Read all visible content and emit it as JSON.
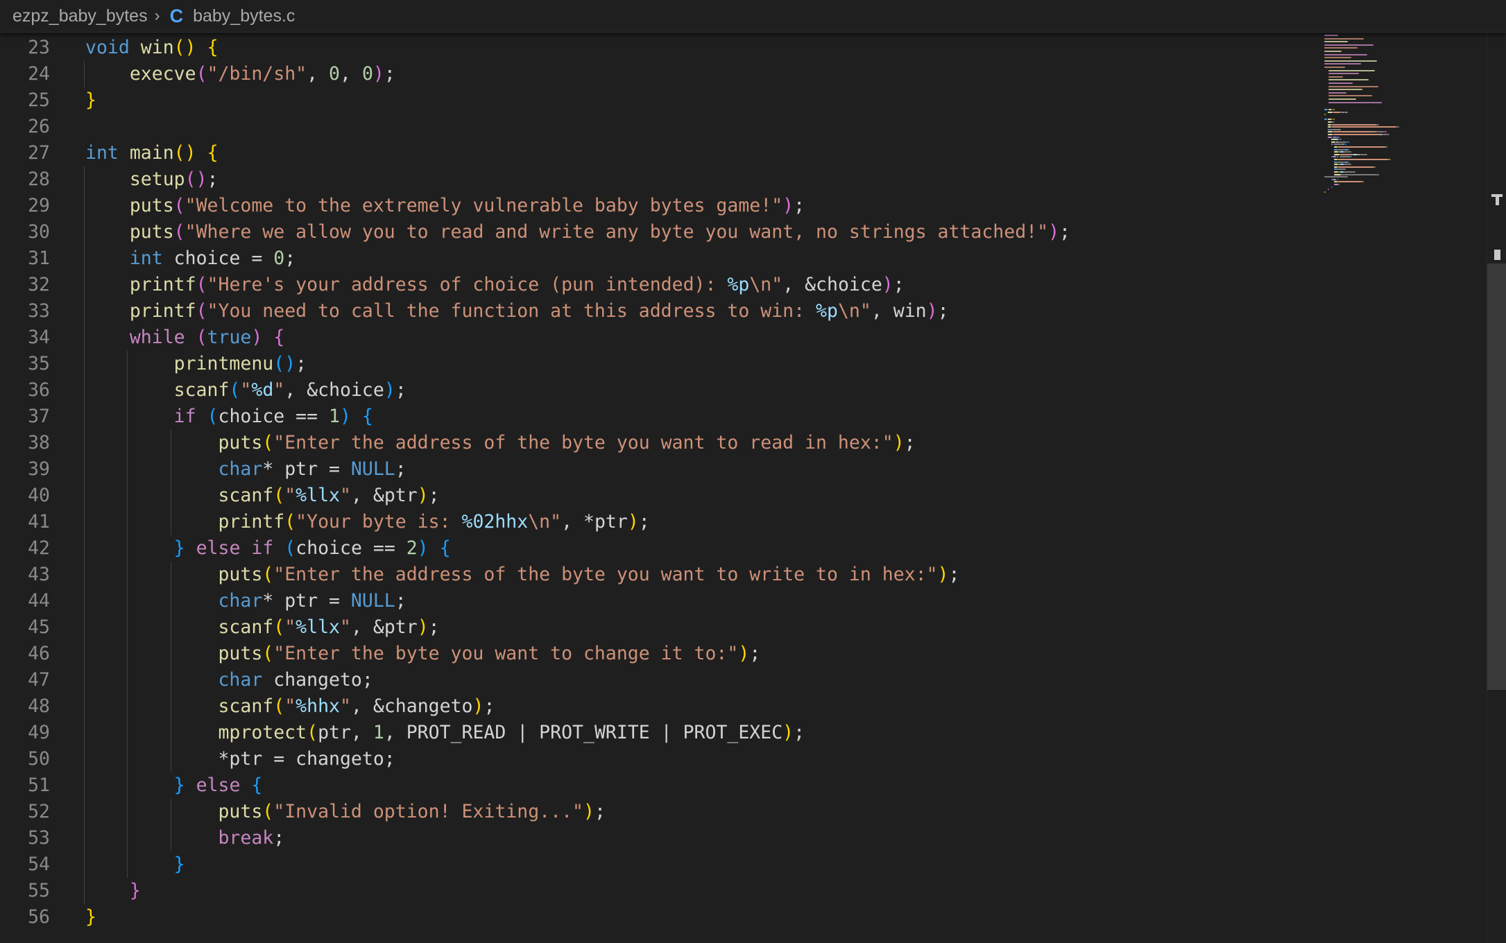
{
  "breadcrumb": {
    "folder": "ezpz_baby_bytes",
    "separator": "›",
    "file_icon": "C",
    "file": "baby_bytes.c"
  },
  "editor": {
    "language": "c",
    "lines": [
      {
        "n": "23",
        "tokens": [
          [
            "kw",
            "void"
          ],
          [
            "plain",
            " "
          ],
          [
            "fn",
            "win"
          ],
          [
            "b1",
            "()"
          ],
          [
            "plain",
            " "
          ],
          [
            "b1",
            "{"
          ]
        ]
      },
      {
        "n": "24",
        "tokens": [
          [
            "plain",
            "    "
          ],
          [
            "fn",
            "execve"
          ],
          [
            "b2",
            "("
          ],
          [
            "str",
            "\"/bin/sh\""
          ],
          [
            "plain",
            ", "
          ],
          [
            "num",
            "0"
          ],
          [
            "plain",
            ", "
          ],
          [
            "num",
            "0"
          ],
          [
            "b2",
            ")"
          ],
          [
            "plain",
            ";"
          ]
        ]
      },
      {
        "n": "25",
        "tokens": [
          [
            "b1",
            "}"
          ]
        ]
      },
      {
        "n": "26",
        "tokens": []
      },
      {
        "n": "27",
        "tokens": [
          [
            "kw",
            "int"
          ],
          [
            "plain",
            " "
          ],
          [
            "fn",
            "main"
          ],
          [
            "b1",
            "()"
          ],
          [
            "plain",
            " "
          ],
          [
            "b1",
            "{"
          ]
        ]
      },
      {
        "n": "28",
        "tokens": [
          [
            "plain",
            "    "
          ],
          [
            "fn",
            "setup"
          ],
          [
            "b2",
            "()"
          ],
          [
            "plain",
            ";"
          ]
        ]
      },
      {
        "n": "29",
        "tokens": [
          [
            "plain",
            "    "
          ],
          [
            "fn",
            "puts"
          ],
          [
            "b2",
            "("
          ],
          [
            "str",
            "\"Welcome to the extremely vulnerable baby bytes game!\""
          ],
          [
            "b2",
            ")"
          ],
          [
            "plain",
            ";"
          ]
        ]
      },
      {
        "n": "30",
        "tokens": [
          [
            "plain",
            "    "
          ],
          [
            "fn",
            "puts"
          ],
          [
            "b2",
            "("
          ],
          [
            "str",
            "\"Where we allow you to read and write any byte you want, no strings attached!\""
          ],
          [
            "b2",
            ")"
          ],
          [
            "plain",
            ";"
          ]
        ]
      },
      {
        "n": "31",
        "tokens": [
          [
            "plain",
            "    "
          ],
          [
            "kw",
            "int"
          ],
          [
            "plain",
            " choice = "
          ],
          [
            "num",
            "0"
          ],
          [
            "plain",
            ";"
          ]
        ]
      },
      {
        "n": "32",
        "tokens": [
          [
            "plain",
            "    "
          ],
          [
            "fn",
            "printf"
          ],
          [
            "b2",
            "("
          ],
          [
            "str",
            "\"Here's your address of choice (pun intended): "
          ],
          [
            "fmt",
            "%p"
          ],
          [
            "str",
            "\\n\""
          ],
          [
            "plain",
            ", &choice"
          ],
          [
            "b2",
            ")"
          ],
          [
            "plain",
            ";"
          ]
        ]
      },
      {
        "n": "33",
        "tokens": [
          [
            "plain",
            "    "
          ],
          [
            "fn",
            "printf"
          ],
          [
            "b2",
            "("
          ],
          [
            "str",
            "\"You need to call the function at this address to win: "
          ],
          [
            "fmt",
            "%p"
          ],
          [
            "str",
            "\\n\""
          ],
          [
            "plain",
            ", win"
          ],
          [
            "b2",
            ")"
          ],
          [
            "plain",
            ";"
          ]
        ]
      },
      {
        "n": "34",
        "tokens": [
          [
            "plain",
            "    "
          ],
          [
            "ctl",
            "while"
          ],
          [
            "plain",
            " "
          ],
          [
            "b2",
            "("
          ],
          [
            "kw",
            "true"
          ],
          [
            "b2",
            ")"
          ],
          [
            "plain",
            " "
          ],
          [
            "b2",
            "{"
          ]
        ]
      },
      {
        "n": "35",
        "tokens": [
          [
            "plain",
            "        "
          ],
          [
            "fn",
            "printmenu"
          ],
          [
            "b3",
            "()"
          ],
          [
            "plain",
            ";"
          ]
        ]
      },
      {
        "n": "36",
        "tokens": [
          [
            "plain",
            "        "
          ],
          [
            "fn",
            "scanf"
          ],
          [
            "b3",
            "("
          ],
          [
            "str",
            "\""
          ],
          [
            "fmt",
            "%d"
          ],
          [
            "str",
            "\""
          ],
          [
            "plain",
            ", &choice"
          ],
          [
            "b3",
            ")"
          ],
          [
            "plain",
            ";"
          ]
        ]
      },
      {
        "n": "37",
        "tokens": [
          [
            "plain",
            "        "
          ],
          [
            "ctl",
            "if"
          ],
          [
            "plain",
            " "
          ],
          [
            "b3",
            "("
          ],
          [
            "plain",
            "choice == "
          ],
          [
            "num",
            "1"
          ],
          [
            "b3",
            ")"
          ],
          [
            "plain",
            " "
          ],
          [
            "b3",
            "{"
          ]
        ]
      },
      {
        "n": "38",
        "tokens": [
          [
            "plain",
            "            "
          ],
          [
            "fn",
            "puts"
          ],
          [
            "b1",
            "("
          ],
          [
            "str",
            "\"Enter the address of the byte you want to read in hex:\""
          ],
          [
            "b1",
            ")"
          ],
          [
            "plain",
            ";"
          ]
        ]
      },
      {
        "n": "39",
        "tokens": [
          [
            "plain",
            "            "
          ],
          [
            "kw",
            "char"
          ],
          [
            "plain",
            "* ptr = "
          ],
          [
            "kw",
            "NULL"
          ],
          [
            "plain",
            ";"
          ]
        ]
      },
      {
        "n": "40",
        "tokens": [
          [
            "plain",
            "            "
          ],
          [
            "fn",
            "scanf"
          ],
          [
            "b1",
            "("
          ],
          [
            "str",
            "\""
          ],
          [
            "fmt",
            "%llx"
          ],
          [
            "str",
            "\""
          ],
          [
            "plain",
            ", &ptr"
          ],
          [
            "b1",
            ")"
          ],
          [
            "plain",
            ";"
          ]
        ]
      },
      {
        "n": "41",
        "tokens": [
          [
            "plain",
            "            "
          ],
          [
            "fn",
            "printf"
          ],
          [
            "b1",
            "("
          ],
          [
            "str",
            "\"Your byte is: "
          ],
          [
            "fmt",
            "%02hhx"
          ],
          [
            "str",
            "\\n\""
          ],
          [
            "plain",
            ", *ptr"
          ],
          [
            "b1",
            ")"
          ],
          [
            "plain",
            ";"
          ]
        ]
      },
      {
        "n": "42",
        "tokens": [
          [
            "plain",
            "        "
          ],
          [
            "b3",
            "}"
          ],
          [
            "plain",
            " "
          ],
          [
            "ctl",
            "else"
          ],
          [
            "plain",
            " "
          ],
          [
            "ctl",
            "if"
          ],
          [
            "plain",
            " "
          ],
          [
            "b3",
            "("
          ],
          [
            "plain",
            "choice == "
          ],
          [
            "num",
            "2"
          ],
          [
            "b3",
            ")"
          ],
          [
            "plain",
            " "
          ],
          [
            "b3",
            "{"
          ]
        ]
      },
      {
        "n": "43",
        "tokens": [
          [
            "plain",
            "            "
          ],
          [
            "fn",
            "puts"
          ],
          [
            "b1",
            "("
          ],
          [
            "str",
            "\"Enter the address of the byte you want to write to in hex:\""
          ],
          [
            "b1",
            ")"
          ],
          [
            "plain",
            ";"
          ]
        ]
      },
      {
        "n": "44",
        "tokens": [
          [
            "plain",
            "            "
          ],
          [
            "kw",
            "char"
          ],
          [
            "plain",
            "* ptr = "
          ],
          [
            "kw",
            "NULL"
          ],
          [
            "plain",
            ";"
          ]
        ]
      },
      {
        "n": "45",
        "tokens": [
          [
            "plain",
            "            "
          ],
          [
            "fn",
            "scanf"
          ],
          [
            "b1",
            "("
          ],
          [
            "str",
            "\""
          ],
          [
            "fmt",
            "%llx"
          ],
          [
            "str",
            "\""
          ],
          [
            "plain",
            ", &ptr"
          ],
          [
            "b1",
            ")"
          ],
          [
            "plain",
            ";"
          ]
        ]
      },
      {
        "n": "46",
        "tokens": [
          [
            "plain",
            "            "
          ],
          [
            "fn",
            "puts"
          ],
          [
            "b1",
            "("
          ],
          [
            "str",
            "\"Enter the byte you want to change it to:\""
          ],
          [
            "b1",
            ")"
          ],
          [
            "plain",
            ";"
          ]
        ]
      },
      {
        "n": "47",
        "tokens": [
          [
            "plain",
            "            "
          ],
          [
            "kw",
            "char"
          ],
          [
            "plain",
            " changeto;"
          ]
        ]
      },
      {
        "n": "48",
        "tokens": [
          [
            "plain",
            "            "
          ],
          [
            "fn",
            "scanf"
          ],
          [
            "b1",
            "("
          ],
          [
            "str",
            "\""
          ],
          [
            "fmt",
            "%hhx"
          ],
          [
            "str",
            "\""
          ],
          [
            "plain",
            ", &changeto"
          ],
          [
            "b1",
            ")"
          ],
          [
            "plain",
            ";"
          ]
        ]
      },
      {
        "n": "49",
        "tokens": [
          [
            "plain",
            "            "
          ],
          [
            "fn",
            "mprotect"
          ],
          [
            "b1",
            "("
          ],
          [
            "plain",
            "ptr, "
          ],
          [
            "num",
            "1"
          ],
          [
            "plain",
            ", PROT_READ | PROT_WRITE | PROT_EXEC"
          ],
          [
            "b1",
            ")"
          ],
          [
            "plain",
            ";"
          ]
        ]
      },
      {
        "n": "50",
        "tokens": [
          [
            "plain",
            "            *ptr = changeto;"
          ]
        ]
      },
      {
        "n": "51",
        "tokens": [
          [
            "plain",
            "        "
          ],
          [
            "b3",
            "}"
          ],
          [
            "plain",
            " "
          ],
          [
            "ctl",
            "else"
          ],
          [
            "plain",
            " "
          ],
          [
            "b3",
            "{"
          ]
        ]
      },
      {
        "n": "52",
        "tokens": [
          [
            "plain",
            "            "
          ],
          [
            "fn",
            "puts"
          ],
          [
            "b1",
            "("
          ],
          [
            "str",
            "\"Invalid option! Exiting...\""
          ],
          [
            "b1",
            ")"
          ],
          [
            "plain",
            ";"
          ]
        ]
      },
      {
        "n": "53",
        "tokens": [
          [
            "plain",
            "            "
          ],
          [
            "ctl",
            "break"
          ],
          [
            "plain",
            ";"
          ]
        ]
      },
      {
        "n": "54",
        "tokens": [
          [
            "plain",
            "        "
          ],
          [
            "b3",
            "}"
          ]
        ]
      },
      {
        "n": "55",
        "tokens": [
          [
            "plain",
            "    "
          ],
          [
            "b2",
            "}"
          ]
        ]
      },
      {
        "n": "56",
        "tokens": [
          [
            "b1",
            "}"
          ]
        ]
      }
    ]
  }
}
